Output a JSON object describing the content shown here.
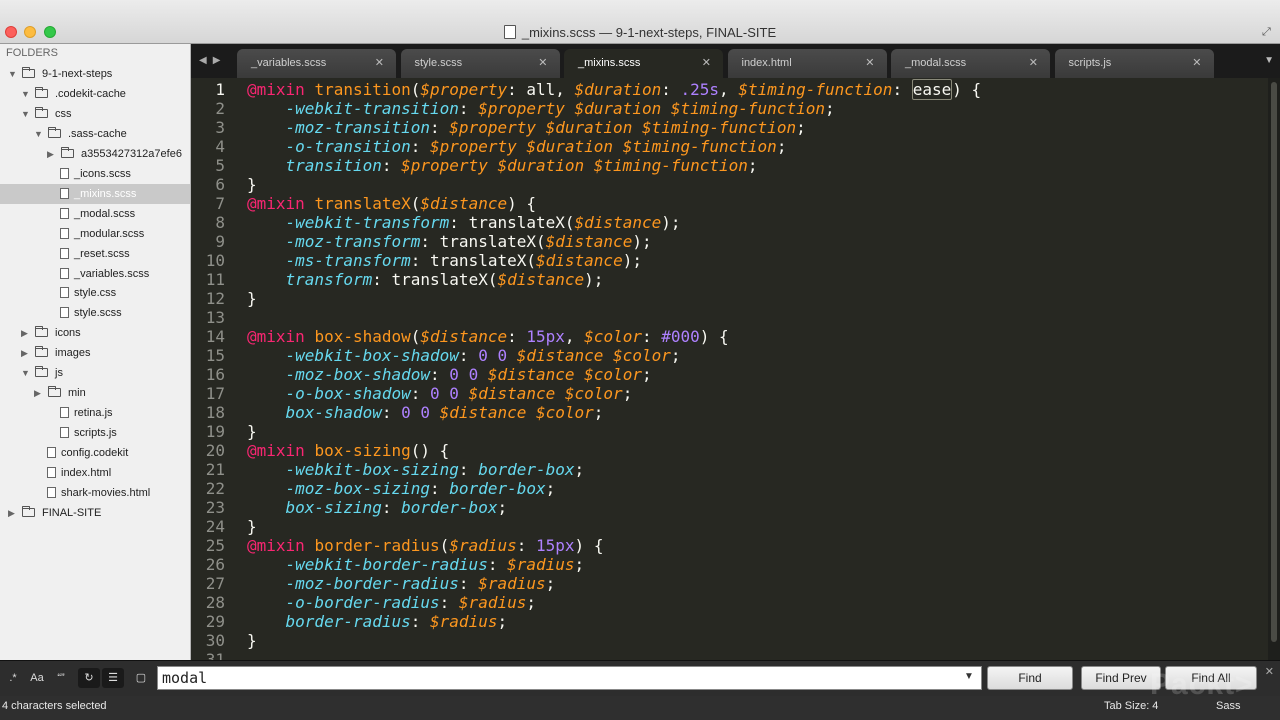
{
  "window": {
    "title": "_mixins.scss — 9-1-next-steps, FINAL-SITE"
  },
  "sidebar": {
    "header": "FOLDERS",
    "items": [
      {
        "label": "9-1-next-steps",
        "kind": "folder",
        "expanded": true,
        "depth": 0
      },
      {
        "label": ".codekit-cache",
        "kind": "folder",
        "expanded": true,
        "depth": 1
      },
      {
        "label": "css",
        "kind": "folder",
        "expanded": true,
        "depth": 1
      },
      {
        "label": ".sass-cache",
        "kind": "folder",
        "expanded": true,
        "depth": 2
      },
      {
        "label": "a3553427312a7efe6",
        "kind": "folder",
        "expanded": false,
        "depth": 3
      },
      {
        "label": "_icons.scss",
        "kind": "file",
        "depth": 2
      },
      {
        "label": "_mixins.scss",
        "kind": "file",
        "depth": 2,
        "selected": true
      },
      {
        "label": "_modal.scss",
        "kind": "file",
        "depth": 2
      },
      {
        "label": "_modular.scss",
        "kind": "file",
        "depth": 2
      },
      {
        "label": "_reset.scss",
        "kind": "file",
        "depth": 2
      },
      {
        "label": "_variables.scss",
        "kind": "file",
        "depth": 2
      },
      {
        "label": "style.css",
        "kind": "file",
        "depth": 2
      },
      {
        "label": "style.scss",
        "kind": "file",
        "depth": 2
      },
      {
        "label": "icons",
        "kind": "folder",
        "expanded": false,
        "depth": 1
      },
      {
        "label": "images",
        "kind": "folder",
        "expanded": false,
        "depth": 1
      },
      {
        "label": "js",
        "kind": "folder",
        "expanded": true,
        "depth": 1
      },
      {
        "label": "min",
        "kind": "folder",
        "expanded": false,
        "depth": 2
      },
      {
        "label": "retina.js",
        "kind": "file",
        "depth": 2
      },
      {
        "label": "scripts.js",
        "kind": "file",
        "depth": 2
      },
      {
        "label": "config.codekit",
        "kind": "file",
        "depth": 1
      },
      {
        "label": "index.html",
        "kind": "file",
        "depth": 1
      },
      {
        "label": "shark-movies.html",
        "kind": "file",
        "depth": 1
      },
      {
        "label": "FINAL-SITE",
        "kind": "folder",
        "expanded": false,
        "depth": 0
      }
    ]
  },
  "tabs": [
    {
      "label": "_variables.scss",
      "active": false
    },
    {
      "label": "style.scss",
      "active": false
    },
    {
      "label": "_mixins.scss",
      "active": true
    },
    {
      "label": "index.html",
      "active": false
    },
    {
      "label": "_modal.scss",
      "active": false
    },
    {
      "label": "scripts.js",
      "active": false
    }
  ],
  "editor": {
    "current_line": 1,
    "line_numbers": [
      "1",
      "2",
      "3",
      "4",
      "5",
      "6",
      "7",
      "8",
      "9",
      "10",
      "11",
      "12",
      "13",
      "14",
      "15",
      "16",
      "17",
      "18",
      "19",
      "20",
      "21",
      "22",
      "23",
      "24",
      "25",
      "26",
      "27",
      "28",
      "29",
      "30",
      "31"
    ],
    "lines": [
      [
        [
          "k",
          "@mixin "
        ],
        [
          "fn",
          "transition"
        ],
        [
          "pl",
          "("
        ],
        [
          "v",
          "$property"
        ],
        [
          "pl",
          ": all, "
        ],
        [
          "v",
          "$duration"
        ],
        [
          "pl",
          ": "
        ],
        [
          "num",
          ".25s"
        ],
        [
          "pl",
          ", "
        ],
        [
          "v",
          "$timing-function"
        ],
        [
          "pl",
          ": "
        ],
        [
          "sel",
          "ease"
        ],
        [
          "pl",
          ") {"
        ]
      ],
      [
        [
          "pl",
          "    "
        ],
        [
          "p",
          "-webkit-transition"
        ],
        [
          "pl",
          ": "
        ],
        [
          "v",
          "$property $duration $timing-function"
        ],
        [
          "pl",
          ";"
        ]
      ],
      [
        [
          "pl",
          "    "
        ],
        [
          "p",
          "-moz-transition"
        ],
        [
          "pl",
          ": "
        ],
        [
          "v",
          "$property $duration $timing-function"
        ],
        [
          "pl",
          ";"
        ]
      ],
      [
        [
          "pl",
          "    "
        ],
        [
          "p",
          "-o-transition"
        ],
        [
          "pl",
          ": "
        ],
        [
          "v",
          "$property $duration $timing-function"
        ],
        [
          "pl",
          ";"
        ]
      ],
      [
        [
          "pl",
          "    "
        ],
        [
          "p",
          "transition"
        ],
        [
          "pl",
          ": "
        ],
        [
          "v",
          "$property $duration $timing-function"
        ],
        [
          "pl",
          ";"
        ]
      ],
      [
        [
          "pl",
          "}"
        ]
      ],
      [
        [
          "k",
          "@mixin "
        ],
        [
          "fn",
          "translateX"
        ],
        [
          "pl",
          "("
        ],
        [
          "v",
          "$distance"
        ],
        [
          "pl",
          ") {"
        ]
      ],
      [
        [
          "pl",
          "    "
        ],
        [
          "p",
          "-webkit-transform"
        ],
        [
          "pl",
          ": translateX("
        ],
        [
          "v",
          "$distance"
        ],
        [
          "pl",
          ");"
        ]
      ],
      [
        [
          "pl",
          "    "
        ],
        [
          "p",
          "-moz-transform"
        ],
        [
          "pl",
          ": translateX("
        ],
        [
          "v",
          "$distance"
        ],
        [
          "pl",
          ");"
        ]
      ],
      [
        [
          "pl",
          "    "
        ],
        [
          "p",
          "-ms-transform"
        ],
        [
          "pl",
          ": translateX("
        ],
        [
          "v",
          "$distance"
        ],
        [
          "pl",
          ");"
        ]
      ],
      [
        [
          "pl",
          "    "
        ],
        [
          "p",
          "transform"
        ],
        [
          "pl",
          ": translateX("
        ],
        [
          "v",
          "$distance"
        ],
        [
          "pl",
          ");"
        ]
      ],
      [
        [
          "pl",
          "}"
        ]
      ],
      [],
      [
        [
          "k",
          "@mixin "
        ],
        [
          "fn",
          "box-shadow"
        ],
        [
          "pl",
          "("
        ],
        [
          "v",
          "$distance"
        ],
        [
          "pl",
          ": "
        ],
        [
          "num",
          "15px"
        ],
        [
          "pl",
          ", "
        ],
        [
          "v",
          "$color"
        ],
        [
          "pl",
          ": "
        ],
        [
          "num",
          "#000"
        ],
        [
          "pl",
          ") {"
        ]
      ],
      [
        [
          "pl",
          "    "
        ],
        [
          "p",
          "-webkit-box-shadow"
        ],
        [
          "pl",
          ": "
        ],
        [
          "num",
          "0 0 "
        ],
        [
          "v",
          "$distance $color"
        ],
        [
          "pl",
          ";"
        ]
      ],
      [
        [
          "pl",
          "    "
        ],
        [
          "p",
          "-moz-box-shadow"
        ],
        [
          "pl",
          ": "
        ],
        [
          "num",
          "0 0 "
        ],
        [
          "v",
          "$distance $color"
        ],
        [
          "pl",
          ";"
        ]
      ],
      [
        [
          "pl",
          "    "
        ],
        [
          "p",
          "-o-box-shadow"
        ],
        [
          "pl",
          ": "
        ],
        [
          "num",
          "0 0 "
        ],
        [
          "v",
          "$distance $color"
        ],
        [
          "pl",
          ";"
        ]
      ],
      [
        [
          "pl",
          "    "
        ],
        [
          "p",
          "box-shadow"
        ],
        [
          "pl",
          ": "
        ],
        [
          "num",
          "0 0 "
        ],
        [
          "v",
          "$distance $color"
        ],
        [
          "pl",
          ";"
        ]
      ],
      [
        [
          "pl",
          "}"
        ]
      ],
      [
        [
          "k",
          "@mixin "
        ],
        [
          "fn",
          "box-sizing"
        ],
        [
          "pl",
          "() {"
        ]
      ],
      [
        [
          "pl",
          "    "
        ],
        [
          "p",
          "-webkit-box-sizing"
        ],
        [
          "pl",
          ": "
        ],
        [
          "p",
          "border-box"
        ],
        [
          "pl",
          ";"
        ]
      ],
      [
        [
          "pl",
          "    "
        ],
        [
          "p",
          "-moz-box-sizing"
        ],
        [
          "pl",
          ": "
        ],
        [
          "p",
          "border-box"
        ],
        [
          "pl",
          ";"
        ]
      ],
      [
        [
          "pl",
          "    "
        ],
        [
          "p",
          "box-sizing"
        ],
        [
          "pl",
          ": "
        ],
        [
          "p",
          "border-box"
        ],
        [
          "pl",
          ";"
        ]
      ],
      [
        [
          "pl",
          "}"
        ]
      ],
      [
        [
          "k",
          "@mixin "
        ],
        [
          "fn",
          "border-radius"
        ],
        [
          "pl",
          "("
        ],
        [
          "v",
          "$radius"
        ],
        [
          "pl",
          ": "
        ],
        [
          "num",
          "15px"
        ],
        [
          "pl",
          ") {"
        ]
      ],
      [
        [
          "pl",
          "    "
        ],
        [
          "p",
          "-webkit-border-radius"
        ],
        [
          "pl",
          ": "
        ],
        [
          "v",
          "$radius"
        ],
        [
          "pl",
          ";"
        ]
      ],
      [
        [
          "pl",
          "    "
        ],
        [
          "p",
          "-moz-border-radius"
        ],
        [
          "pl",
          ": "
        ],
        [
          "v",
          "$radius"
        ],
        [
          "pl",
          ";"
        ]
      ],
      [
        [
          "pl",
          "    "
        ],
        [
          "p",
          "-o-border-radius"
        ],
        [
          "pl",
          ": "
        ],
        [
          "v",
          "$radius"
        ],
        [
          "pl",
          ";"
        ]
      ],
      [
        [
          "pl",
          "    "
        ],
        [
          "p",
          "border-radius"
        ],
        [
          "pl",
          ": "
        ],
        [
          "v",
          "$radius"
        ],
        [
          "pl",
          ";"
        ]
      ],
      [
        [
          "pl",
          "}"
        ]
      ],
      []
    ]
  },
  "findbar": {
    "options": [
      {
        "icon": "regex-icon",
        "glyph": ".*"
      },
      {
        "icon": "case-sensitive-icon",
        "glyph": "Aa"
      },
      {
        "icon": "whole-word-icon",
        "glyph": "“”"
      },
      {
        "icon": "wrap-icon",
        "glyph": "↻"
      },
      {
        "icon": "in-selection-icon",
        "glyph": "☰"
      },
      {
        "icon": "highlight-matches-icon",
        "glyph": "▢"
      }
    ],
    "query": "modal",
    "find_label": "Find",
    "find_prev_label": "Find Prev",
    "find_all_label": "Find All"
  },
  "statusbar": {
    "selection": "4 characters selected",
    "tab_size": "Tab Size: 4",
    "syntax": "Sass"
  },
  "watermark": "Packt>"
}
